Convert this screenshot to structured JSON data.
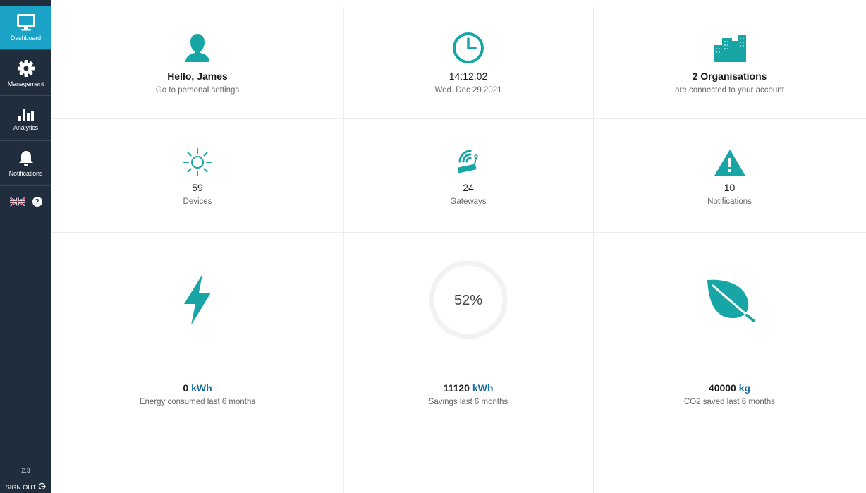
{
  "sidebar": {
    "items": [
      {
        "label": "Dashboard",
        "icon": "monitor-icon",
        "active": true
      },
      {
        "label": "Management",
        "icon": "gear-icon",
        "active": false
      },
      {
        "label": "Analytics",
        "icon": "bar-chart-icon",
        "active": false
      },
      {
        "label": "Notifications",
        "icon": "bell-icon",
        "active": false
      }
    ],
    "language_icon": "uk-flag-icon",
    "help_label": "?",
    "version": "2.3",
    "signout_label": "SIGN OUT"
  },
  "cards": {
    "user": {
      "title": "Hello, James",
      "subtitle": "Go to personal settings",
      "icon": "user-icon"
    },
    "clock": {
      "time": "14:12:02",
      "date": "Wed. Dec 29 2021",
      "icon": "clock-icon"
    },
    "orgs": {
      "title": "2 Organisations",
      "subtitle": "are connected to your account",
      "icon": "buildings-icon"
    },
    "devices": {
      "value": "59",
      "label": "Devices",
      "icon": "sun-icon"
    },
    "gateways": {
      "value": "24",
      "label": "Gateways",
      "icon": "gateway-icon"
    },
    "notifications": {
      "value": "10",
      "label": "Notifications",
      "icon": "warning-icon"
    },
    "energy": {
      "value": "0",
      "unit": "kWh",
      "label": "Energy consumed last 6 months",
      "icon": "lightning-icon"
    },
    "savings": {
      "percent_label": "52%",
      "percent": 52,
      "value": "11120",
      "unit": "kWh",
      "label": "Savings last 6 months"
    },
    "co2": {
      "value": "40000",
      "unit": "kg",
      "label": "CO2 saved last 6 months",
      "icon": "leaf-icon"
    }
  },
  "colors": {
    "accent": "#1aa3c7",
    "teal": "#17a5a5",
    "sidebar": "#1f2d3d",
    "unit": "#1b6fa0"
  }
}
